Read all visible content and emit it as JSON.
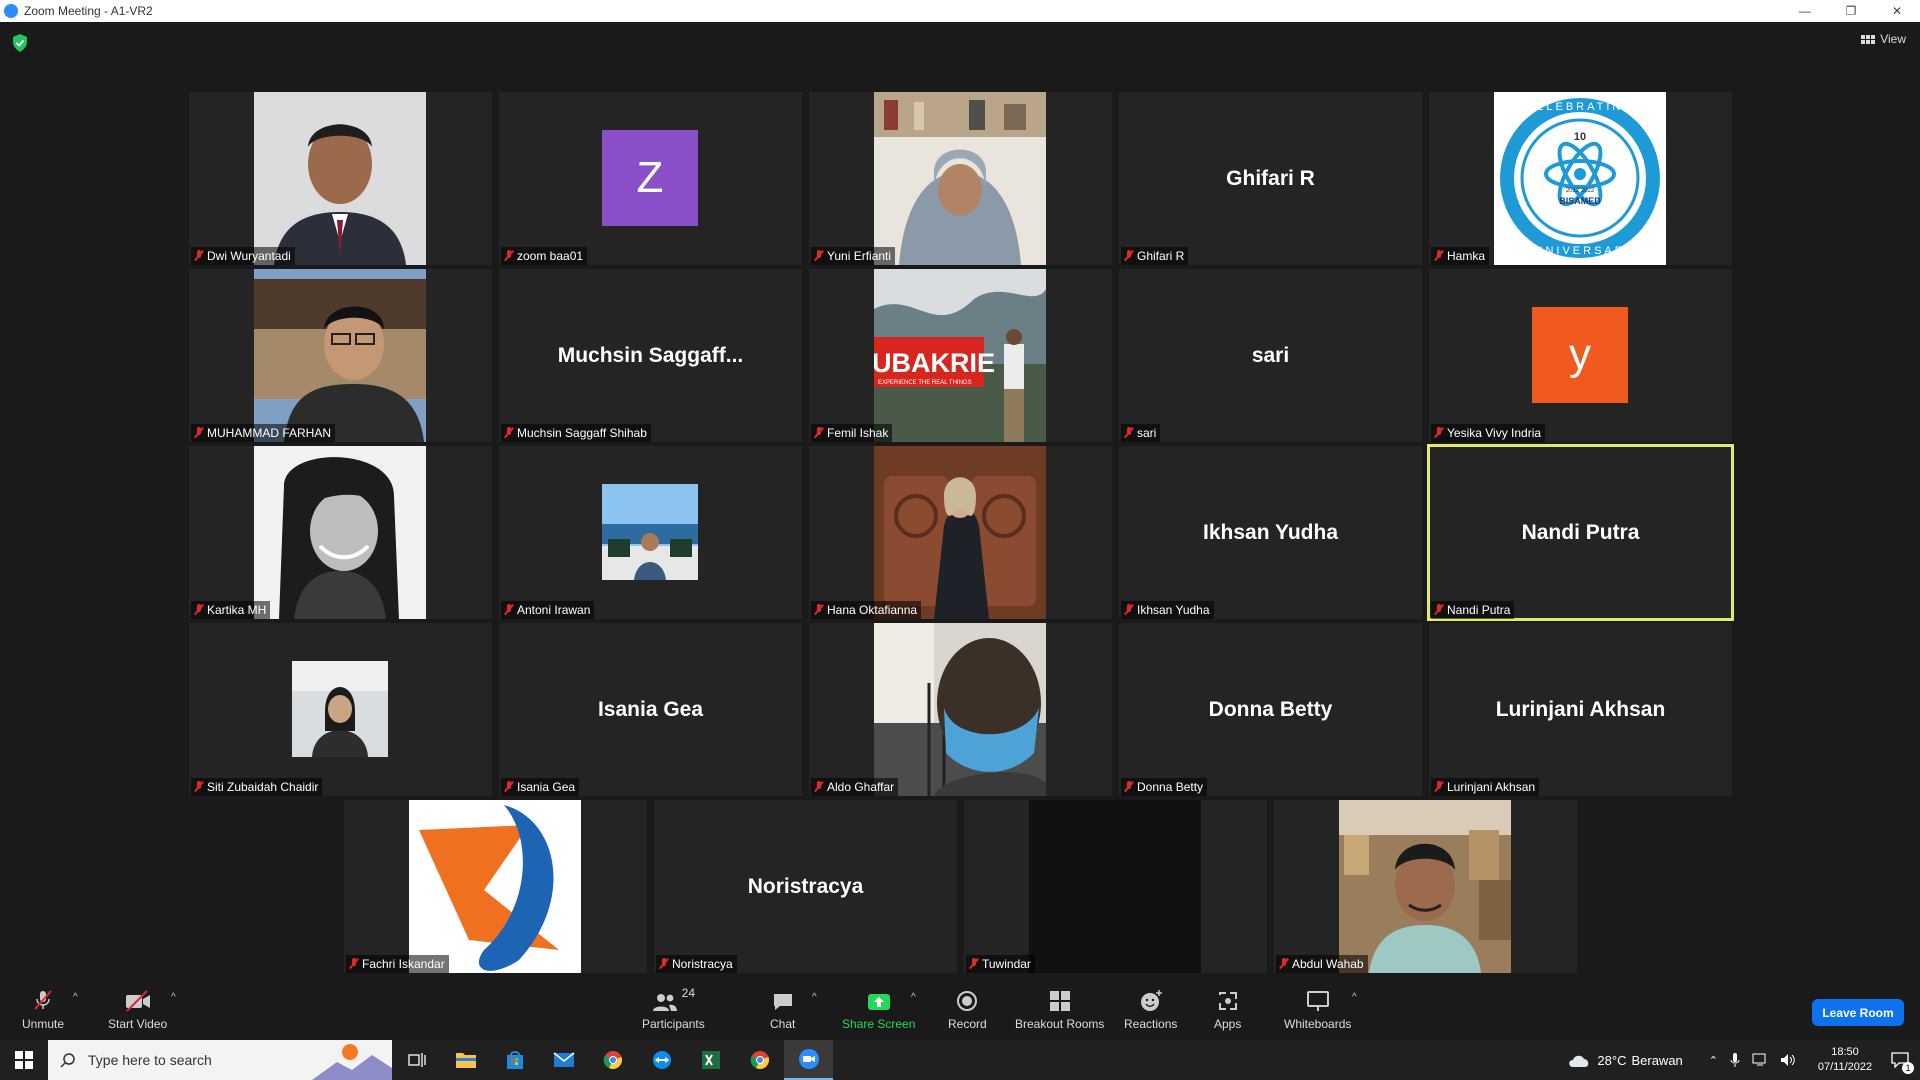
{
  "window": {
    "title": "Zoom Meeting - A1-VR2",
    "minimize": "—",
    "restore": "❐",
    "close": "✕"
  },
  "meeting": {
    "view_label": "View"
  },
  "tiles": [
    {
      "name": "Dwi Wuryantadi",
      "display": "photo"
    },
    {
      "name": "zoom baa01",
      "display": "avatar",
      "avatar_letter": "Z",
      "avatar_color": "#8b4fc9"
    },
    {
      "name": "Yuni Erfianti",
      "display": "photo"
    },
    {
      "name": "Ghifari R",
      "display": "text",
      "center_text": "Ghifari R"
    },
    {
      "name": "Hamka",
      "display": "logo"
    },
    {
      "name": "MUHAMMAD FARHAN",
      "display": "photo"
    },
    {
      "name": "Muchsin Saggaff Shihab",
      "display": "text",
      "center_text": "Muchsin  Saggaff..."
    },
    {
      "name": "Femil Ishak",
      "display": "photo",
      "overlay_text": "UBAKRIE",
      "overlay_sub": "EXPERIENCE THE REAL THINGS"
    },
    {
      "name": "sari",
      "display": "text",
      "center_text": "sari"
    },
    {
      "name": "Yesika Vivy Indria",
      "display": "avatar",
      "avatar_letter": "y",
      "avatar_color": "#f05a1e"
    },
    {
      "name": "Kartika MH",
      "display": "photo"
    },
    {
      "name": "Antoni Irawan",
      "display": "small-photo"
    },
    {
      "name": "Hana Oktafianna",
      "display": "photo"
    },
    {
      "name": "Ikhsan Yudha",
      "display": "text",
      "center_text": "Ikhsan Yudha"
    },
    {
      "name": "Nandi Putra",
      "display": "text",
      "center_text": "Nandi Putra",
      "active_speaker": true
    },
    {
      "name": "Siti Zubaidah Chaidir",
      "display": "small-photo"
    },
    {
      "name": "Isania Gea",
      "display": "text",
      "center_text": "Isania Gea"
    },
    {
      "name": "Aldo Ghaffar",
      "display": "photo"
    },
    {
      "name": "Donna Betty",
      "display": "text",
      "center_text": "Donna Betty"
    },
    {
      "name": "Lurinjani Akhsan",
      "display": "text",
      "center_text": "Lurinjani Akhsan"
    },
    {
      "name": "Fachri Iskandar",
      "display": "logo2"
    },
    {
      "name": "Noristracya",
      "display": "text",
      "center_text": "Noristracya"
    },
    {
      "name": "Tuwindar",
      "display": "dark"
    },
    {
      "name": "Abdul Wahab",
      "display": "photo"
    }
  ],
  "toolbar": {
    "unmute": "Unmute",
    "start_video": "Start Video",
    "participants": "Participants",
    "participants_count": "24",
    "chat": "Chat",
    "share_screen": "Share Screen",
    "record": "Record",
    "breakout_rooms": "Breakout Rooms",
    "reactions": "Reactions",
    "apps": "Apps",
    "whiteboards": "Whiteboards",
    "leave": "Leave Room",
    "caret": "^"
  },
  "taskbar": {
    "search_placeholder": "Type here to search",
    "weather_temp": "28°C",
    "weather_desc": "Berawan",
    "time": "18:50",
    "date": "07/11/2022",
    "notifications": "1"
  },
  "logos": {
    "bisamed_top": "CELEBRATING",
    "bisamed_bottom": "ANNIVERSARY",
    "bisamed_num": "10",
    "bisamed_name": "BISAMED",
    "bisamed_years": "2012   2022"
  }
}
